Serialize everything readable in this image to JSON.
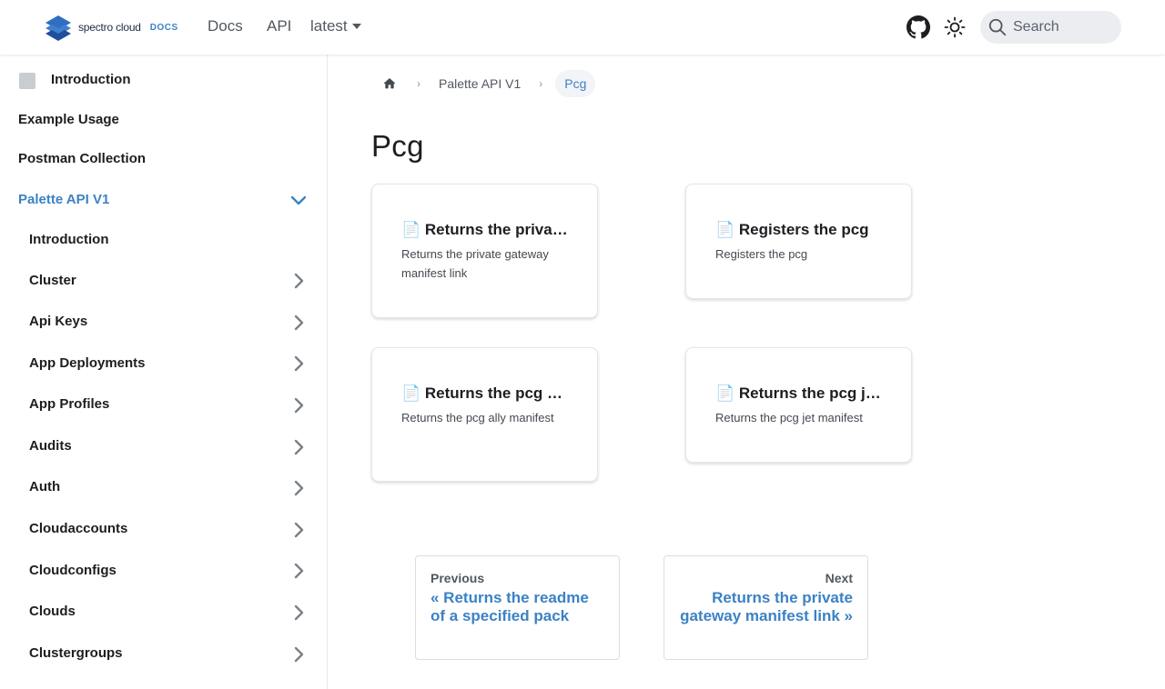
{
  "header": {
    "logo_text": "spectro cloud",
    "logo_tag": "DOCS",
    "nav": {
      "docs": "Docs",
      "api": "API",
      "version": "latest"
    },
    "search_placeholder": "Search"
  },
  "sidebar": {
    "top_items": [
      "Introduction",
      "Example Usage",
      "Postman Collection"
    ],
    "section": "Palette API V1",
    "sub_items": [
      "Introduction",
      "Cluster",
      "Api Keys",
      "App Deployments",
      "App Profiles",
      "Audits",
      "Auth",
      "Cloudaccounts",
      "Cloudconfigs",
      "Clouds",
      "Clustergroups"
    ]
  },
  "breadcrumb": {
    "parent": "Palette API V1",
    "current": "Pcg"
  },
  "page_title": "Pcg",
  "cards": [
    {
      "title": "📄️ Returns the private gateway manifest link",
      "desc": "Returns the private gateway manifest link"
    },
    {
      "title": "📄️ Registers the pcg",
      "desc": "Registers the pcg"
    },
    {
      "title": "📄️ Returns the pcg ally manifest",
      "desc": "Returns the pcg ally manifest"
    },
    {
      "title": "📄️ Returns the pcg jet manifest",
      "desc": "Returns the pcg jet manifest"
    }
  ],
  "pager": {
    "prev_label": "Previous",
    "prev_link": "« Returns the readme of a specified pack",
    "next_label": "Next",
    "next_link": "Returns the private gateway manifest link »"
  },
  "colors": {
    "accent": "#3b82c4",
    "text": "#1c1e21"
  }
}
